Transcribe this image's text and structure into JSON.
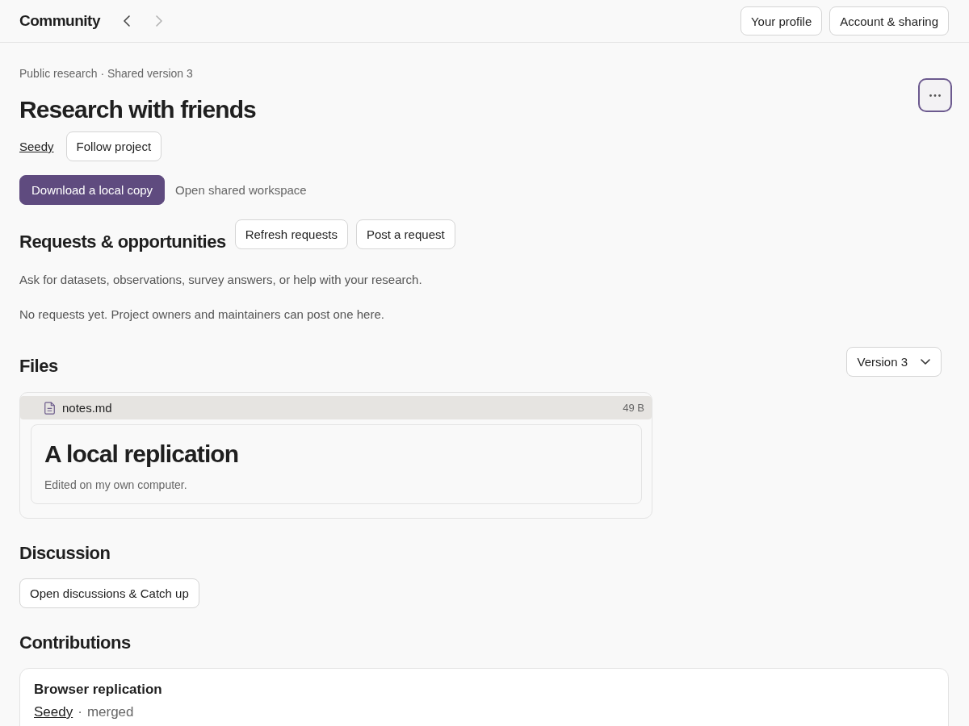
{
  "top_bar": {
    "title": "Community",
    "nav": [
      {
        "kind": "back",
        "disabled": false
      },
      {
        "kind": "forward",
        "disabled": true
      }
    ],
    "buttons": [
      "Your profile",
      "Account & sharing"
    ]
  },
  "project": {
    "breadcrumb": "Public research · Shared version 3",
    "title": "Research with friends",
    "owner": "Seedy",
    "follow_button": "Follow project",
    "more_button": {
      "focused": true
    },
    "primary_action": "Download a local copy",
    "secondary_action": "Open shared workspace"
  },
  "requests": {
    "title": "Requests & opportunities",
    "buttons": [
      "Refresh requests",
      "Post a request"
    ],
    "description": "Ask for datasets, observations, survey answers, or help with your research.",
    "empty_message": "No requests yet. Project owners and maintainers can post one here."
  },
  "files": {
    "title": "Files",
    "version_select": "Version 3",
    "items": [
      {
        "name": "notes.md",
        "size": "49 B",
        "preview": {
          "heading": "A local replication",
          "text": "Edited on my own computer."
        }
      }
    ]
  },
  "discussion": {
    "title": "Discussion",
    "button": "Open discussions & Catch up"
  },
  "contributions": {
    "title": "Contributions",
    "items": [
      {
        "title": "Browser replication",
        "author": "Seedy",
        "separator": "·",
        "status": "merged"
      }
    ]
  }
}
